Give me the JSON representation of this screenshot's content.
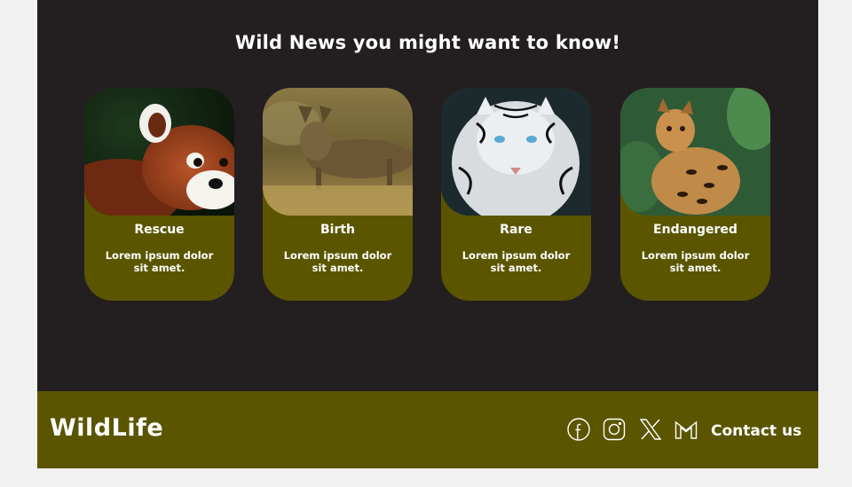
{
  "news": {
    "title": "Wild News you might want to know!",
    "cards": [
      {
        "title": "Rescue",
        "text": "Lorem ipsum dolor sit amet.",
        "image": "red-panda-image"
      },
      {
        "title": "Birth",
        "text": "Lorem ipsum dolor sit amet.",
        "image": "serval-kitten-image"
      },
      {
        "title": "Rare",
        "text": "Lorem ipsum dolor sit amet.",
        "image": "white-tiger-image"
      },
      {
        "title": "Endangered",
        "text": "Lorem ipsum dolor sit amet.",
        "image": "ocelot-image"
      }
    ]
  },
  "footer": {
    "brand": "WildLife",
    "social": [
      "facebook-icon",
      "instagram-icon",
      "x-icon",
      "gmail-icon"
    ],
    "contact_label": "Contact us"
  },
  "colors": {
    "news_background": "#231f20",
    "olive": "#5b5500",
    "page_background": "#f1f1f1",
    "text": "#ffffff"
  }
}
